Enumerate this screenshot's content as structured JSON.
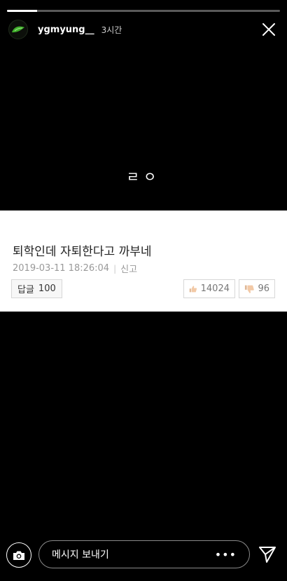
{
  "progress": {
    "fraction": 0.11
  },
  "header": {
    "username": "ygmyung__",
    "time_ago": "3시간"
  },
  "story": {
    "overlay_text": "ㄹㅇ"
  },
  "post": {
    "title": "퇴학인데 자퇴한다고 까부네",
    "date": "2019-03-11 18:26:04",
    "separator": "|",
    "report_label": "신고",
    "reply_label": "답글",
    "reply_count": "100",
    "upvotes": "14024",
    "downvotes": "96"
  },
  "footer": {
    "message_placeholder": "메시지 보내기",
    "more_label": "•••"
  },
  "icons": {
    "avatar": "avatar-icon",
    "close": "close-icon",
    "thumbs_up": "thumbs-up-icon",
    "thumbs_down": "thumbs-down-icon",
    "camera": "camera-icon",
    "send": "send-icon"
  },
  "colors": {
    "background": "#000000",
    "card": "#ffffff",
    "accent_avatar": "#3fae2a"
  }
}
